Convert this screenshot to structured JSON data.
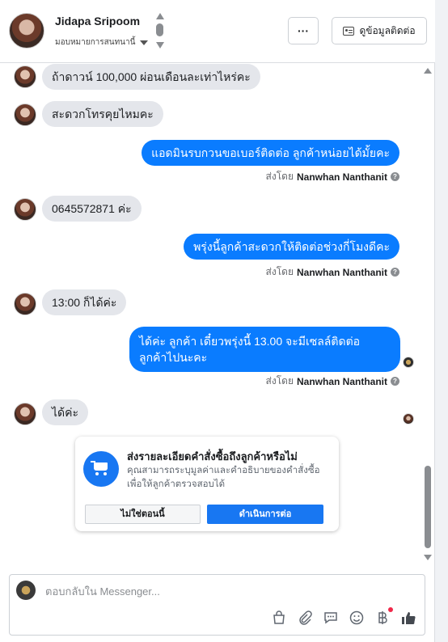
{
  "header": {
    "contact_name": "Jidapa Sripoom",
    "assign_label": "มอบหมายการสนทนานี้",
    "more_label": "···",
    "contact_info_label": "ดูข้อมูลติดต่อ"
  },
  "messages": [
    {
      "dir": "in",
      "text": "ถ้าดาวน์ 100,000 ผ่อนเดือนละเท่าไหร่คะ"
    },
    {
      "dir": "in",
      "text": "สะดวกโทรคุยไหมคะ"
    },
    {
      "dir": "out",
      "text": "แอดมินรบกวนขอเบอร์ติดต่อ ลูกค้าหน่อยได้มั้ยคะ",
      "sent_prefix": "ส่งโดย",
      "sent_by": "Nanwhan Nanthanit"
    },
    {
      "dir": "in",
      "text": "0645572871 ค่ะ"
    },
    {
      "dir": "out",
      "text": "พรุ่งนี้ลูกค้าสะดวกให้ติดต่อช่วงกี่โมงดีคะ",
      "sent_prefix": "ส่งโดย",
      "sent_by": "Nanwhan Nanthanit"
    },
    {
      "dir": "in",
      "text": "13:00 ก็ได้ค่ะ"
    },
    {
      "dir": "out",
      "text": "ได้ค่ะ  ลูกค้า เดี๋ยวพรุ่งนี้ 13.00 จะมีเซลล์ติดต่อ ลูกค้าไปนะคะ",
      "sent_prefix": "ส่งโดย",
      "sent_by": "Nanwhan Nanthanit"
    },
    {
      "dir": "in",
      "text": "ได้ค่ะ"
    }
  ],
  "order_prompt": {
    "title": "ส่งรายละเอียดคำสั่งซื้อถึงลูกค้าหรือไม่",
    "description": "คุณสามารถระบุมูลค่าและคำอธิบายของคำสั่งซื้อเพื่อให้ลูกค้าตรวจสอบได้",
    "not_now_label": "ไม่ใช่ตอนนี้",
    "continue_label": "ดำเนินการต่อ"
  },
  "composer": {
    "placeholder": "ตอบกลับใน Messenger...",
    "tools": [
      "shopping-bag-icon",
      "paperclip-icon",
      "saved-replies-icon",
      "emoji-icon",
      "baht-payment-icon",
      "thumbs-up-icon"
    ]
  },
  "colors": {
    "outgoing_bubble": "#0a7cff",
    "incoming_bubble": "#e4e6eb",
    "primary_button": "#1877f2",
    "notification_dot": "#f02849"
  }
}
